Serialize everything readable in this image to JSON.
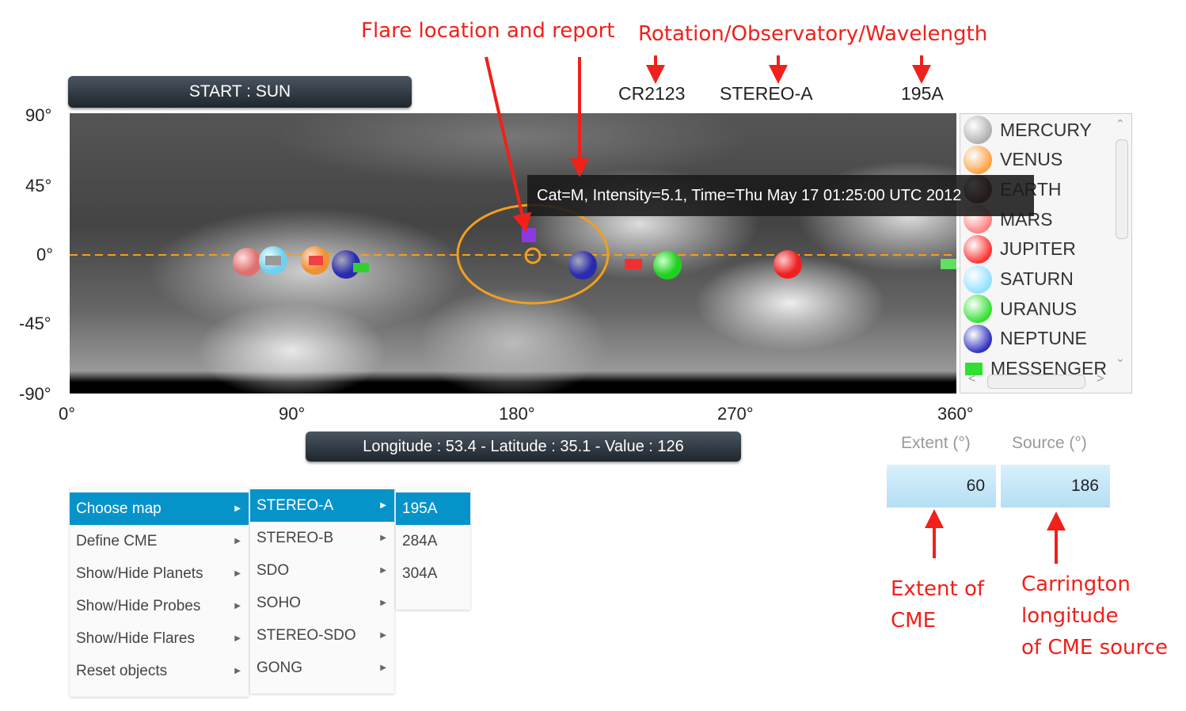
{
  "annotations": {
    "flare": "Flare location and report",
    "rotation": "Rotation/Observatory/Wavelength",
    "extent": [
      "Extent of",
      "CME"
    ],
    "source": [
      "Carrington",
      "longitude",
      "of CME source"
    ]
  },
  "start_button": "START : SUN",
  "header": {
    "rotation": "CR2123",
    "observatory": "STEREO-A",
    "wavelength": "195A"
  },
  "lat_ticks": [
    "90°",
    "45°",
    "0°",
    "-45°",
    "-90°"
  ],
  "lon_ticks": [
    "0°",
    "90°",
    "180°",
    "270°",
    "360°"
  ],
  "tooltip": "Cat=M, Intensity=5.1, Time=Thu May 17 01:25:00 UTC 2012",
  "status": "Longitude : 53.4 - Latitude : 35.1 - Value : 126",
  "legend": [
    {
      "label": "MERCURY",
      "color": "#b0b0b0",
      "shape": "sphere"
    },
    {
      "label": "VENUS",
      "color": "#ffa040",
      "shape": "sphere"
    },
    {
      "label": "EARTH",
      "color": "#6a2020",
      "shape": "sphere"
    },
    {
      "label": "MARS",
      "color": "#ff8080",
      "shape": "sphere"
    },
    {
      "label": "JUPITER",
      "color": "#ff3030",
      "shape": "sphere"
    },
    {
      "label": "SATURN",
      "color": "#90e0ff",
      "shape": "sphere"
    },
    {
      "label": "URANUS",
      "color": "#30e030",
      "shape": "sphere"
    },
    {
      "label": "NEPTUNE",
      "color": "#3030c0",
      "shape": "sphere"
    },
    {
      "label": "MESSENGER",
      "color": "#30e030",
      "shape": "square"
    }
  ],
  "menu": {
    "main": [
      {
        "label": "Choose map",
        "selected": true
      },
      {
        "label": "Define CME"
      },
      {
        "label": "Show/Hide Planets"
      },
      {
        "label": "Show/Hide Probes"
      },
      {
        "label": "Show/Hide Flares"
      },
      {
        "label": "Reset objects"
      }
    ],
    "observatories": [
      {
        "label": "STEREO-A",
        "selected": true
      },
      {
        "label": "STEREO-B"
      },
      {
        "label": "SDO"
      },
      {
        "label": "SOHO"
      },
      {
        "label": "STEREO-SDO"
      },
      {
        "label": "GONG"
      }
    ],
    "wavelengths": [
      {
        "label": "195A",
        "selected": true
      },
      {
        "label": "284A"
      },
      {
        "label": "304A"
      }
    ]
  },
  "cme": {
    "extent_label": "Extent (°)",
    "extent_value": "60",
    "source_label": "Source (°)",
    "source_value": "186"
  },
  "colors": {
    "accent": "#0693c9",
    "annotation": "#f0201a",
    "cme_ellipse": "#f0a020"
  }
}
